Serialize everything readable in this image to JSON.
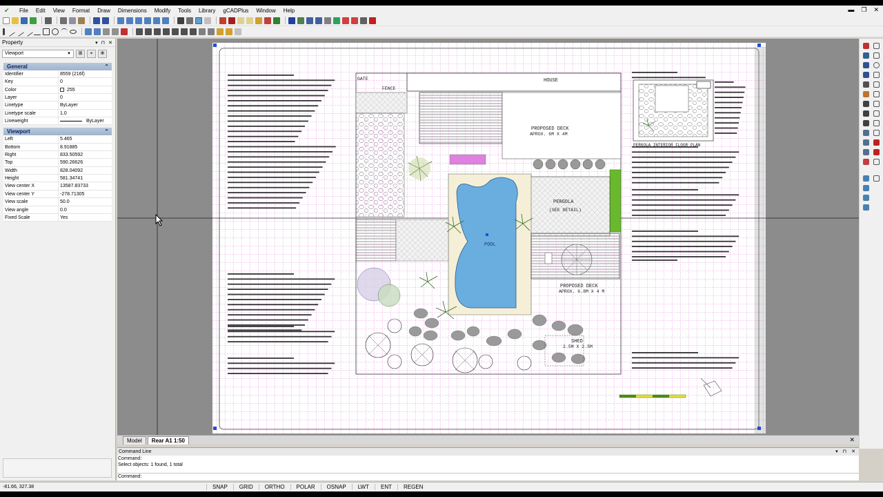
{
  "menu": {
    "items": [
      "File",
      "Edit",
      "View",
      "Format",
      "Draw",
      "Dimensions",
      "Modify",
      "Tools",
      "Library",
      "gCADPlus",
      "Window",
      "Help"
    ]
  },
  "property_panel": {
    "title": "Property",
    "selector_value": "Viewport",
    "groups": {
      "general": {
        "title": "General",
        "rows": [
          {
            "key": "Identifier",
            "value": "8559 (216f)"
          },
          {
            "key": "Key",
            "value": "0"
          },
          {
            "key": "Color",
            "value": "255"
          },
          {
            "key": "Layer",
            "value": "0"
          },
          {
            "key": "Linetype",
            "value": "ByLayer"
          },
          {
            "key": "Linetype scale",
            "value": "1.0"
          },
          {
            "key": "Lineweight",
            "value": "ByLayer"
          }
        ]
      },
      "viewport": {
        "title": "Viewport",
        "rows": [
          {
            "key": "Left",
            "value": "5.465"
          },
          {
            "key": "Bottom",
            "value": "8.91885"
          },
          {
            "key": "Right",
            "value": "833.50592"
          },
          {
            "key": "Top",
            "value": "590.26626"
          },
          {
            "key": "Width",
            "value": "828.04092"
          },
          {
            "key": "Height",
            "value": "581.34741"
          },
          {
            "key": "View center X",
            "value": "13587.83733"
          },
          {
            "key": "View center Y",
            "value": "-278.71305"
          },
          {
            "key": "View scale",
            "value": "50.0"
          },
          {
            "key": "View angle",
            "value": "0.0"
          },
          {
            "key": "Fixed Scale",
            "value": "Yes"
          }
        ]
      }
    }
  },
  "drawing": {
    "labels": {
      "gate": "GATE",
      "fence": "FENCE",
      "house": "HOUSE",
      "deck1_title": "PROPOSED DECK",
      "deck1_size": "APROX. 6M X 4M",
      "pergola": "PERGOLA",
      "see_detail": "(SEE DETAIL)",
      "pool": "POOL",
      "deck2_title": "PROPOSED DECK",
      "deck2_size": "APROX. 6.8M X 4 M",
      "shed": "SHED",
      "shed_size": "2.5M X 2.5M",
      "pergola_plan": "PERGOLA INTERIOR FLOOR PLAN"
    },
    "colors": {
      "grid": "#d23cc8",
      "pool": "#6aaee0",
      "canvas_bg": "#8c8c8c",
      "sheet_bg": "#ffffff",
      "accent_green": "#6ab82e"
    }
  },
  "tabs": {
    "items": [
      "Model",
      "Rear A1 1:50"
    ],
    "active_index": 1
  },
  "command_line": {
    "title": "Command Line",
    "history": [
      "Command:",
      "Select objects:  1 found,  1 total"
    ],
    "prompt": "Command:"
  },
  "status_bar": {
    "coords": "-81.66, 327.38",
    "buttons": [
      "SNAP",
      "GRID",
      "ORTHO",
      "POLAR",
      "OSNAP",
      "LWT",
      "ENT",
      "REGEN"
    ]
  }
}
